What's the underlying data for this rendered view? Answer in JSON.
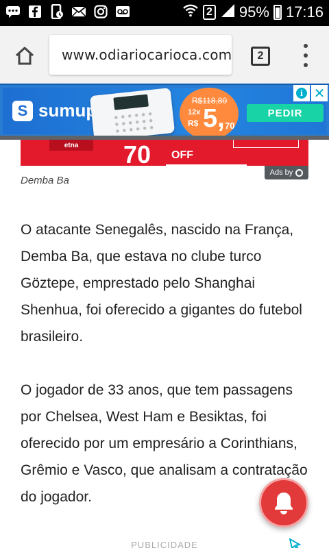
{
  "status_bar": {
    "notification_icons": [
      "chat-bubble-icon",
      "facebook-icon",
      "phone-data-icon",
      "mail-icon",
      "instagram-icon",
      "voicemail-icon"
    ],
    "sim": "2",
    "battery": "95%",
    "time": "17:16"
  },
  "browser": {
    "url": "www.odiariocarioca.com",
    "tab_count": "2"
  },
  "ad_banner": {
    "brand": "sumup",
    "brand_mark": "S",
    "old_price": "R$118,80",
    "installments": "12x",
    "currency": "R$",
    "price_main": "5,",
    "price_cents": "70",
    "cta": "PEDIR",
    "adchoices": "i",
    "close": "✕",
    "colors": {
      "background": "#1d6fd1",
      "cta": "#18d3a6",
      "price_badge": "#ff8a3d"
    }
  },
  "article_image": {
    "badge": "etna",
    "number": "70",
    "off": "OFF",
    "ads_by": "Ads by"
  },
  "caption": "Demba Ba",
  "paragraphs": [
    "O atacante Senegalês, nascido na França, Demba Ba,  que estava no clube turco Göztepe, emprestado pelo Shanghai Shenhua, foi oferecido a gigantes do futebol brasileiro.",
    "O jogador de 33 anos, que tem passagens por Chelsea, West Ham e Besiktas, foi oferecido por um empresário a Corinthians, Grêmio e Vasco, que analisam a contratação do jogador."
  ],
  "publicidade": "PUBLICIDADE",
  "notification_bell": {
    "color": "#e2393b"
  }
}
